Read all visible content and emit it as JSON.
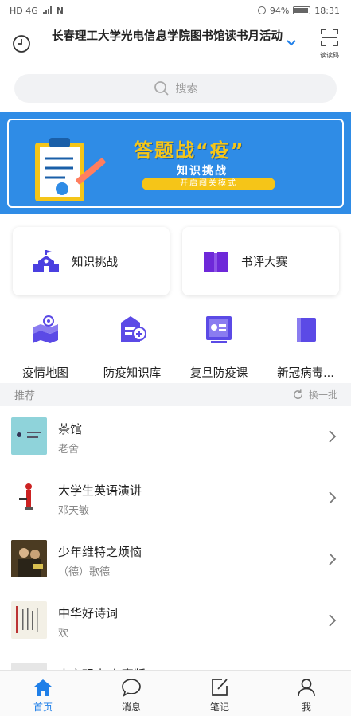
{
  "status_bar": {
    "left_text": "HD 4G",
    "nfc": "N",
    "battery": "94%",
    "time": "18:31"
  },
  "header": {
    "title": "长春理工大学光电信息学院图书馆读书月活动",
    "scan_label": "读读码"
  },
  "search": {
    "placeholder": "搜索"
  },
  "banner": {
    "title": "答题战“疫”",
    "subtitle": "知识挑战",
    "button": "开启闯关模式"
  },
  "cards": [
    {
      "label": "知识挑战",
      "icon": "school-icon",
      "color": "#4a3fe0"
    },
    {
      "label": "书评大赛",
      "icon": "open-book-icon",
      "color": "#6e28d9"
    }
  ],
  "grid": [
    {
      "label": "疫情地图",
      "icon": "map-icon"
    },
    {
      "label": "防疫知识库",
      "icon": "knowledge-base-icon"
    },
    {
      "label": "复旦防疫课",
      "icon": "course-icon"
    },
    {
      "label": "新冠病毒...",
      "icon": "book-icon"
    }
  ],
  "recommend": {
    "title": "推荐",
    "refresh_label": "换一批"
  },
  "books": [
    {
      "title": "茶馆",
      "author": "老舍"
    },
    {
      "title": "大学生英语演讲",
      "author": "邓天敏"
    },
    {
      "title": "少年维特之烦恼",
      "author": "（德）歌德"
    },
    {
      "title": "中华好诗词",
      "author": "欢"
    },
    {
      "title": "古文观止 有声版",
      "author": ""
    }
  ],
  "nav": [
    {
      "label": "首页",
      "icon": "home-icon",
      "active": true
    },
    {
      "label": "消息",
      "icon": "message-icon",
      "active": false
    },
    {
      "label": "笔记",
      "icon": "note-icon",
      "active": false
    },
    {
      "label": "我",
      "icon": "profile-icon",
      "active": false
    }
  ],
  "colors": {
    "accent": "#1f7fe8",
    "banner_bg": "#2f8ce6",
    "banner_title": "#f5c518",
    "icon_purple": "#5b4ae6"
  }
}
